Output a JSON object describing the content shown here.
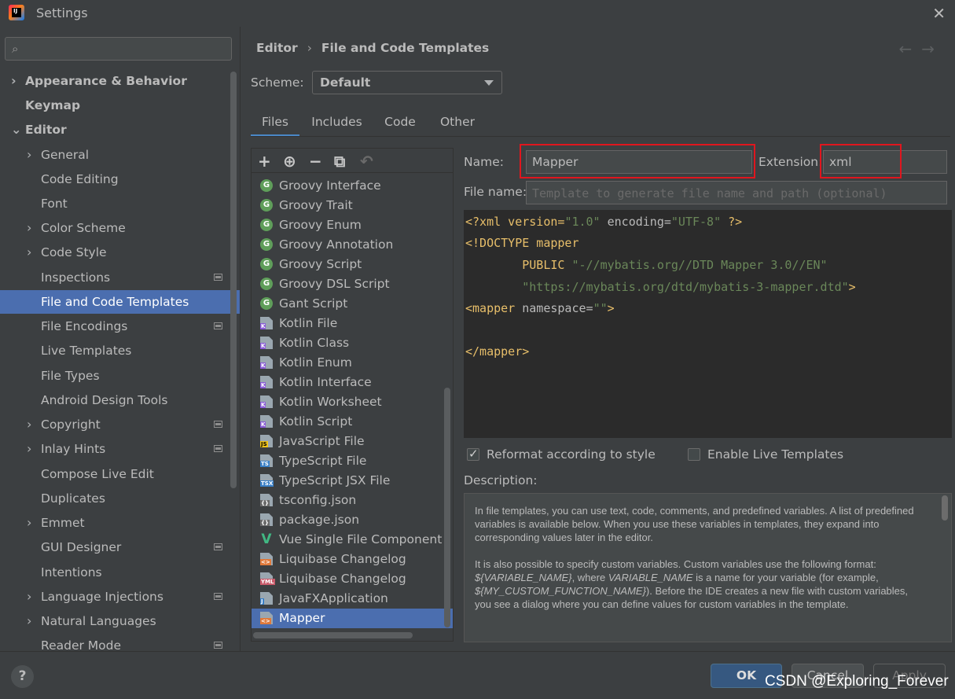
{
  "window": {
    "title": "Settings"
  },
  "search": {
    "placeholder": "",
    "value": ""
  },
  "sidebar": {
    "items": [
      {
        "label": "Appearance & Behavior",
        "bold": true,
        "chevron": "›"
      },
      {
        "label": "Keymap",
        "bold": true,
        "chevron": ""
      },
      {
        "label": "Editor",
        "bold": true,
        "chevron": "⌄"
      },
      {
        "label": "General",
        "chevron": "›"
      },
      {
        "label": "Code Editing",
        "chevron": ""
      },
      {
        "label": "Font",
        "chevron": ""
      },
      {
        "label": "Color Scheme",
        "chevron": "›"
      },
      {
        "label": "Code Style",
        "chevron": "›"
      },
      {
        "label": "Inspections",
        "chevron": ""
      },
      {
        "label": "File and Code Templates",
        "chevron": ""
      },
      {
        "label": "File Encodings",
        "chevron": ""
      },
      {
        "label": "Live Templates",
        "chevron": ""
      },
      {
        "label": "File Types",
        "chevron": ""
      },
      {
        "label": "Android Design Tools",
        "chevron": ""
      },
      {
        "label": "Copyright",
        "chevron": "›"
      },
      {
        "label": "Inlay Hints",
        "chevron": "›"
      },
      {
        "label": "Compose Live Edit",
        "chevron": ""
      },
      {
        "label": "Duplicates",
        "chevron": ""
      },
      {
        "label": "Emmet",
        "chevron": "›"
      },
      {
        "label": "GUI Designer",
        "chevron": ""
      },
      {
        "label": "Intentions",
        "chevron": ""
      },
      {
        "label": "Language Injections",
        "chevron": "›"
      },
      {
        "label": "Natural Languages",
        "chevron": "›"
      },
      {
        "label": "Reader Mode",
        "chevron": ""
      }
    ],
    "selected": "File and Code Templates"
  },
  "breadcrumb": {
    "parent": "Editor",
    "separator": "›",
    "current": "File and Code Templates"
  },
  "nav": {
    "back": "←",
    "forward": "→"
  },
  "scheme": {
    "label": "Scheme:",
    "value": "Default"
  },
  "tabs": [
    "Files",
    "Includes",
    "Code",
    "Other"
  ],
  "toolbar": {
    "add": "+",
    "add_child": "⊕",
    "remove": "−",
    "copy": "⧉",
    "reset": "↶"
  },
  "templates": [
    {
      "name": "Groovy Interface",
      "icon": "groovy-icon"
    },
    {
      "name": "Groovy Trait",
      "icon": "groovy-icon"
    },
    {
      "name": "Groovy Enum",
      "icon": "groovy-icon"
    },
    {
      "name": "Groovy Annotation",
      "icon": "groovy-icon"
    },
    {
      "name": "Groovy Script",
      "icon": "groovy-icon"
    },
    {
      "name": "Groovy DSL Script",
      "icon": "groovy-icon"
    },
    {
      "name": "Gant Script",
      "icon": "groovy-icon"
    },
    {
      "name": "Kotlin File",
      "icon": "kotlin-file-icon"
    },
    {
      "name": "Kotlin Class",
      "icon": "kotlin-file-icon"
    },
    {
      "name": "Kotlin Enum",
      "icon": "kotlin-file-icon"
    },
    {
      "name": "Kotlin Interface",
      "icon": "kotlin-file-icon"
    },
    {
      "name": "Kotlin Worksheet",
      "icon": "kotlin-file-icon"
    },
    {
      "name": "Kotlin Script",
      "icon": "kotlin-file-icon"
    },
    {
      "name": "JavaScript File",
      "icon": "js-file-icon"
    },
    {
      "name": "TypeScript File",
      "icon": "ts-file-icon"
    },
    {
      "name": "TypeScript JSX File",
      "icon": "tsx-file-icon"
    },
    {
      "name": "tsconfig.json",
      "icon": "json-file-icon"
    },
    {
      "name": "package.json",
      "icon": "json-file-icon"
    },
    {
      "name": "Vue Single File Component",
      "icon": "vue-icon"
    },
    {
      "name": "Liquibase Changelog",
      "icon": "xml-file-icon"
    },
    {
      "name": "Liquibase Changelog",
      "icon": "yaml-file-icon"
    },
    {
      "name": "JavaFXApplication",
      "icon": "java-file-icon"
    },
    {
      "name": "Mapper",
      "icon": "xml-file-icon"
    }
  ],
  "selected_template": "Mapper",
  "form": {
    "name_label": "Name:",
    "name_value": "Mapper",
    "extension_label": "Extension:",
    "extension_value": "xml",
    "filename_label": "File name:",
    "filename_placeholder": "Template to generate file name and path (optional)"
  },
  "code": {
    "l1_a": "<?xml version=",
    "l1_b": "\"1.0\"",
    "l1_c": " encoding=",
    "l1_d": "\"UTF-8\"",
    "l1_e": " ?>",
    "l2_a": "<!DOCTYPE mapper",
    "l3_a": "        PUBLIC ",
    "l3_b": "\"-//mybatis.org//DTD Mapper 3.0//EN\"",
    "l4_a": "        ",
    "l4_b": "\"https://mybatis.org/dtd/mybatis-3-mapper.dtd\"",
    "l4_c": ">",
    "l5_a": "<mapper",
    "l5_b": " namespace=",
    "l5_c": "\"\"",
    "l5_d": ">",
    "l7_a": "</mapper>"
  },
  "options": {
    "reformat_label": "Reformat according to style",
    "reformat_checked": true,
    "live_templates_label": "Enable Live Templates",
    "live_templates_checked": false
  },
  "description": {
    "label": "Description:",
    "p1": "In file templates, you can use text, code, comments, and predefined variables. A list of predefined variables is available below. When you use these variables in templates, they expand into corresponding values later in the editor.",
    "p2_a": "It is also possible to specify custom variables. Custom variables use the following format: ",
    "p2_var": "${VARIABLE_NAME}",
    "p2_b": ", where ",
    "p2_var2": "VARIABLE_NAME",
    "p2_c": " is a name for your variable (for example, ",
    "p2_var3": "${MY_CUSTOM_FUNCTION_NAME}",
    "p2_d": "). Before the IDE creates a new file with custom variables, you see a dialog where you can define values for custom variables in the template."
  },
  "buttons": {
    "ok": "OK",
    "cancel": "Cancel",
    "apply": "Apply",
    "help": "?"
  },
  "watermark": "CSDN @Exploring_Forever",
  "colors": {
    "selection": "#4b6eaf",
    "highlight_box": "#e0161e",
    "ok_button": "#365880"
  }
}
